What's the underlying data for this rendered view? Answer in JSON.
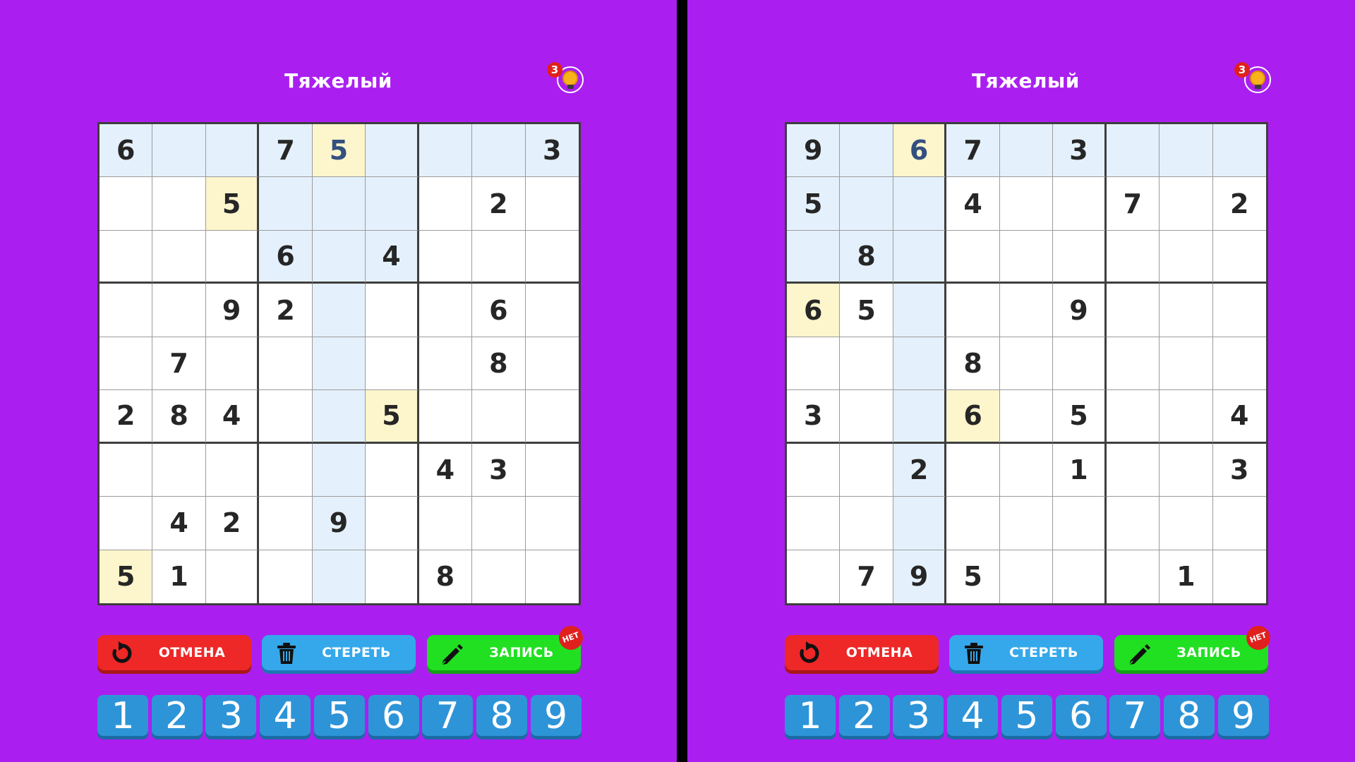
{
  "panels": [
    {
      "id": "left",
      "title": "Тяжелый",
      "hints_count": "3",
      "grid": [
        [
          "6",
          "",
          "",
          "7",
          "5",
          "",
          "",
          "",
          "3"
        ],
        [
          "",
          "",
          "5",
          "",
          "",
          "",
          "",
          "2",
          ""
        ],
        [
          "",
          "",
          "",
          "6",
          "",
          "4",
          "",
          "",
          ""
        ],
        [
          "",
          "",
          "9",
          "2",
          "",
          "",
          "",
          "6",
          ""
        ],
        [
          "",
          "7",
          "",
          "",
          "",
          "",
          "",
          "8",
          ""
        ],
        [
          "2",
          "8",
          "4",
          "",
          "",
          "5",
          "",
          "",
          ""
        ],
        [
          "",
          "",
          "",
          "",
          "",
          "",
          "4",
          "3",
          ""
        ],
        [
          "",
          "4",
          "2",
          "",
          "9",
          "",
          "",
          "",
          ""
        ],
        [
          "5",
          "1",
          "",
          "",
          "",
          "",
          "8",
          "",
          ""
        ]
      ],
      "selected_cell": [
        0,
        4
      ],
      "same_value_cells": [
        [
          1,
          2
        ],
        [
          5,
          5
        ],
        [
          8,
          0
        ]
      ],
      "highlighted_cells": [
        [
          0,
          0
        ],
        [
          0,
          1
        ],
        [
          0,
          2
        ],
        [
          0,
          3
        ],
        [
          0,
          5
        ],
        [
          0,
          6
        ],
        [
          0,
          7
        ],
        [
          0,
          8
        ],
        [
          1,
          3
        ],
        [
          1,
          4
        ],
        [
          1,
          5
        ],
        [
          2,
          3
        ],
        [
          2,
          4
        ],
        [
          2,
          5
        ],
        [
          3,
          4
        ],
        [
          4,
          4
        ],
        [
          5,
          4
        ],
        [
          6,
          4
        ],
        [
          7,
          4
        ],
        [
          8,
          4
        ]
      ]
    },
    {
      "id": "right",
      "title": "Тяжелый",
      "hints_count": "3",
      "grid": [
        [
          "9",
          "",
          "6",
          "7",
          "",
          "3",
          "",
          "",
          ""
        ],
        [
          "5",
          "",
          "",
          "4",
          "",
          "",
          "7",
          "",
          "2"
        ],
        [
          "",
          "8",
          "",
          "",
          "",
          "",
          "",
          "",
          ""
        ],
        [
          "6",
          "5",
          "",
          "",
          "",
          "9",
          "",
          "",
          ""
        ],
        [
          "",
          "",
          "",
          "8",
          "",
          "",
          "",
          "",
          ""
        ],
        [
          "3",
          "",
          "",
          "6",
          "",
          "5",
          "",
          "",
          "4"
        ],
        [
          "",
          "",
          "2",
          "",
          "",
          "1",
          "",
          "",
          "3"
        ],
        [
          "",
          "",
          "",
          "",
          "",
          "",
          "",
          "",
          ""
        ],
        [
          "",
          "7",
          "9",
          "5",
          "",
          "",
          "",
          "1",
          ""
        ]
      ],
      "selected_cell": [
        0,
        2
      ],
      "same_value_cells": [
        [
          3,
          0
        ],
        [
          5,
          3
        ]
      ],
      "highlighted_cells": [
        [
          0,
          0
        ],
        [
          0,
          1
        ],
        [
          0,
          3
        ],
        [
          0,
          4
        ],
        [
          0,
          5
        ],
        [
          0,
          6
        ],
        [
          0,
          7
        ],
        [
          0,
          8
        ],
        [
          1,
          0
        ],
        [
          1,
          1
        ],
        [
          1,
          2
        ],
        [
          2,
          0
        ],
        [
          2,
          1
        ],
        [
          2,
          2
        ],
        [
          3,
          2
        ],
        [
          4,
          2
        ],
        [
          5,
          2
        ],
        [
          6,
          2
        ],
        [
          7,
          2
        ],
        [
          8,
          2
        ]
      ]
    }
  ],
  "actions": {
    "undo_label": "ОТМЕНА",
    "erase_label": "СТЕРЕТЬ",
    "notes_label": "ЗАПИСЬ",
    "notes_state": "НЕТ"
  },
  "numpad": [
    "1",
    "2",
    "3",
    "4",
    "5",
    "6",
    "7",
    "8",
    "9"
  ],
  "icons": {
    "undo": "undo-arrow-icon",
    "erase": "trash-icon",
    "notes": "pencil-icon",
    "hint": "lightbulb-icon"
  },
  "colors": {
    "background": "#aa1ff0",
    "cell_highlight": "#e4f1fd",
    "cell_same_value": "#fdf5cc",
    "undo_button": "#ee2727",
    "erase_button": "#35a8eb",
    "notes_button": "#21e021",
    "numpad_button": "#2e94d8",
    "badge": "#e0201d"
  }
}
